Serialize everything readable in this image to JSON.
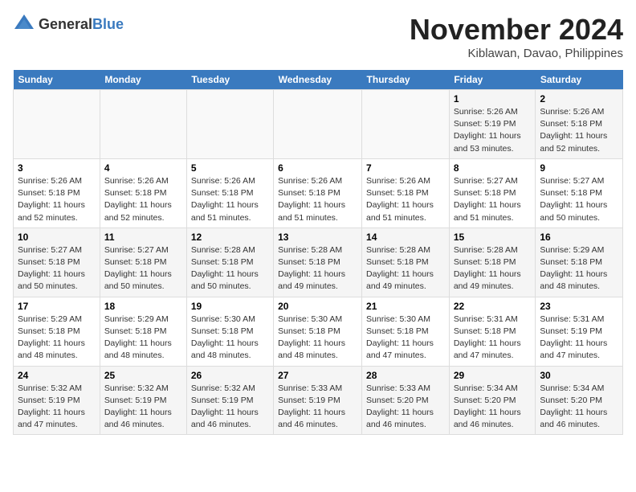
{
  "header": {
    "logo_general": "General",
    "logo_blue": "Blue",
    "month_title": "November 2024",
    "location": "Kiblawan, Davao, Philippines"
  },
  "weekdays": [
    "Sunday",
    "Monday",
    "Tuesday",
    "Wednesday",
    "Thursday",
    "Friday",
    "Saturday"
  ],
  "weeks": [
    [
      {
        "day": "",
        "info": ""
      },
      {
        "day": "",
        "info": ""
      },
      {
        "day": "",
        "info": ""
      },
      {
        "day": "",
        "info": ""
      },
      {
        "day": "",
        "info": ""
      },
      {
        "day": "1",
        "info": "Sunrise: 5:26 AM\nSunset: 5:19 PM\nDaylight: 11 hours and 53 minutes."
      },
      {
        "day": "2",
        "info": "Sunrise: 5:26 AM\nSunset: 5:18 PM\nDaylight: 11 hours and 52 minutes."
      }
    ],
    [
      {
        "day": "3",
        "info": "Sunrise: 5:26 AM\nSunset: 5:18 PM\nDaylight: 11 hours and 52 minutes."
      },
      {
        "day": "4",
        "info": "Sunrise: 5:26 AM\nSunset: 5:18 PM\nDaylight: 11 hours and 52 minutes."
      },
      {
        "day": "5",
        "info": "Sunrise: 5:26 AM\nSunset: 5:18 PM\nDaylight: 11 hours and 51 minutes."
      },
      {
        "day": "6",
        "info": "Sunrise: 5:26 AM\nSunset: 5:18 PM\nDaylight: 11 hours and 51 minutes."
      },
      {
        "day": "7",
        "info": "Sunrise: 5:26 AM\nSunset: 5:18 PM\nDaylight: 11 hours and 51 minutes."
      },
      {
        "day": "8",
        "info": "Sunrise: 5:27 AM\nSunset: 5:18 PM\nDaylight: 11 hours and 51 minutes."
      },
      {
        "day": "9",
        "info": "Sunrise: 5:27 AM\nSunset: 5:18 PM\nDaylight: 11 hours and 50 minutes."
      }
    ],
    [
      {
        "day": "10",
        "info": "Sunrise: 5:27 AM\nSunset: 5:18 PM\nDaylight: 11 hours and 50 minutes."
      },
      {
        "day": "11",
        "info": "Sunrise: 5:27 AM\nSunset: 5:18 PM\nDaylight: 11 hours and 50 minutes."
      },
      {
        "day": "12",
        "info": "Sunrise: 5:28 AM\nSunset: 5:18 PM\nDaylight: 11 hours and 50 minutes."
      },
      {
        "day": "13",
        "info": "Sunrise: 5:28 AM\nSunset: 5:18 PM\nDaylight: 11 hours and 49 minutes."
      },
      {
        "day": "14",
        "info": "Sunrise: 5:28 AM\nSunset: 5:18 PM\nDaylight: 11 hours and 49 minutes."
      },
      {
        "day": "15",
        "info": "Sunrise: 5:28 AM\nSunset: 5:18 PM\nDaylight: 11 hours and 49 minutes."
      },
      {
        "day": "16",
        "info": "Sunrise: 5:29 AM\nSunset: 5:18 PM\nDaylight: 11 hours and 48 minutes."
      }
    ],
    [
      {
        "day": "17",
        "info": "Sunrise: 5:29 AM\nSunset: 5:18 PM\nDaylight: 11 hours and 48 minutes."
      },
      {
        "day": "18",
        "info": "Sunrise: 5:29 AM\nSunset: 5:18 PM\nDaylight: 11 hours and 48 minutes."
      },
      {
        "day": "19",
        "info": "Sunrise: 5:30 AM\nSunset: 5:18 PM\nDaylight: 11 hours and 48 minutes."
      },
      {
        "day": "20",
        "info": "Sunrise: 5:30 AM\nSunset: 5:18 PM\nDaylight: 11 hours and 48 minutes."
      },
      {
        "day": "21",
        "info": "Sunrise: 5:30 AM\nSunset: 5:18 PM\nDaylight: 11 hours and 47 minutes."
      },
      {
        "day": "22",
        "info": "Sunrise: 5:31 AM\nSunset: 5:18 PM\nDaylight: 11 hours and 47 minutes."
      },
      {
        "day": "23",
        "info": "Sunrise: 5:31 AM\nSunset: 5:19 PM\nDaylight: 11 hours and 47 minutes."
      }
    ],
    [
      {
        "day": "24",
        "info": "Sunrise: 5:32 AM\nSunset: 5:19 PM\nDaylight: 11 hours and 47 minutes."
      },
      {
        "day": "25",
        "info": "Sunrise: 5:32 AM\nSunset: 5:19 PM\nDaylight: 11 hours and 46 minutes."
      },
      {
        "day": "26",
        "info": "Sunrise: 5:32 AM\nSunset: 5:19 PM\nDaylight: 11 hours and 46 minutes."
      },
      {
        "day": "27",
        "info": "Sunrise: 5:33 AM\nSunset: 5:19 PM\nDaylight: 11 hours and 46 minutes."
      },
      {
        "day": "28",
        "info": "Sunrise: 5:33 AM\nSunset: 5:20 PM\nDaylight: 11 hours and 46 minutes."
      },
      {
        "day": "29",
        "info": "Sunrise: 5:34 AM\nSunset: 5:20 PM\nDaylight: 11 hours and 46 minutes."
      },
      {
        "day": "30",
        "info": "Sunrise: 5:34 AM\nSunset: 5:20 PM\nDaylight: 11 hours and 46 minutes."
      }
    ]
  ]
}
